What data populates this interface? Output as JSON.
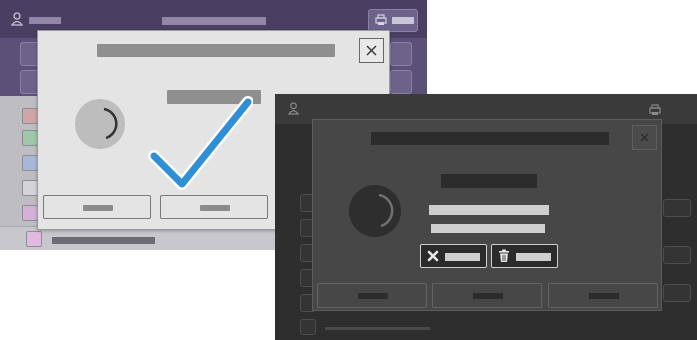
{
  "back_screen": {
    "dialog": {
      "close_icon": "close-icon",
      "status": "complete",
      "checkmark_color": "#2f8fd6"
    },
    "header_icons": [
      "user-icon",
      "printer-icon"
    ]
  },
  "front_screen": {
    "dialog": {
      "close_icon": "close-icon",
      "status": "in-progress",
      "action_icons": [
        "cancel-x-icon",
        "delete-trash-icon"
      ]
    },
    "header_icons": [
      "user-icon",
      "printer-icon"
    ]
  },
  "colors": {
    "accent_blue": "#2f8fd6",
    "light_header": "#4a3f63",
    "dark_background": "#2e2e2e"
  }
}
